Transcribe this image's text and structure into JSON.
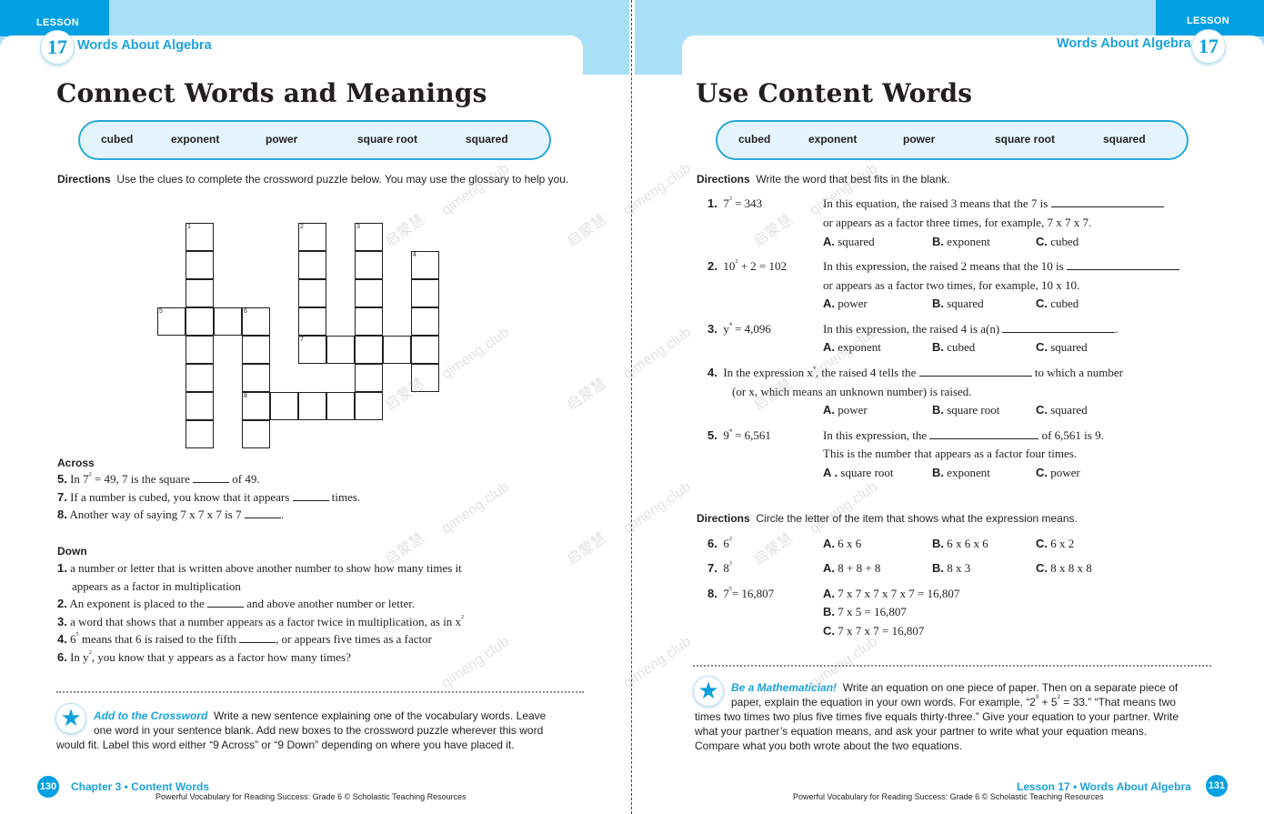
{
  "colors": {
    "accent": "#00a0e3",
    "band": "#a9dff7",
    "word_box_fill": "#e4f4fc",
    "word_box_border": "#29a8dd",
    "text": "#231f20"
  },
  "left": {
    "lesson_label": "LESSON",
    "lesson_number": "17",
    "lesson_title": "Words About Algebra",
    "heading": "Connect Words and Meanings",
    "word_bank": [
      "cubed",
      "exponent",
      "power",
      "square root",
      "squared"
    ],
    "directions_label": "Directions",
    "directions_text": "Use the clues to complete the crossword puzzle below. You may use the glossary to help you.",
    "crossword_numbers": [
      "1",
      "2",
      "3",
      "4",
      "5",
      "6",
      "7",
      "8"
    ],
    "across_label": "Across",
    "across": [
      {
        "n": "5.",
        "a": "In 7",
        "sup": "2",
        "b": " = 49, 7 is the square ",
        "c": " of 49."
      },
      {
        "n": "7.",
        "a": "If a number is cubed, you know that it appears ",
        "c": " times."
      },
      {
        "n": "8.",
        "a": "Another way of saying 7 x 7 x 7 is 7 ",
        "c": "."
      }
    ],
    "down_label": "Down",
    "down": [
      {
        "n": "1.",
        "a": "a number or letter that is written above another number to show how many times it",
        "a2": "appears as a factor in multiplication"
      },
      {
        "n": "2.",
        "a": "An exponent is placed to the ",
        "c": " and above another number or letter."
      },
      {
        "n": "3.",
        "a": "a word that shows that a number appears as a factor twice in multiplication, as in x",
        "sup": "2"
      },
      {
        "n": "4.",
        "a": "6",
        "sup": "5",
        "b": " means that 6 is raised to the fifth ",
        "c": ", or appears five times as a factor"
      },
      {
        "n": "6.",
        "a": "In y",
        "sup": "2",
        "b": ", you know that y appears as a factor how many times?"
      }
    ],
    "activity_title": "Add to the Crossword",
    "activity_line1": "Write a new sentence explaining one of the vocabulary words. Leave",
    "activity_line2": "one word in your sentence blank. Add new boxes to the crossword puzzle wherever this word",
    "activity_line3": "would fit. Label this word either “9 Across” or “9 Down” depending on where you have placed it.",
    "page_number": "130",
    "footer_chapter": "Chapter 3  •  Content Words",
    "footer_credit": "Powerful Vocabulary for Reading Success: Grade 6 © Scholastic Teaching Resources"
  },
  "right": {
    "lesson_label": "LESSON",
    "lesson_number": "17",
    "lesson_title": "Words About Algebra",
    "heading": "Use Content Words",
    "word_bank": [
      "cubed",
      "exponent",
      "power",
      "square root",
      "squared"
    ],
    "directions1_label": "Directions",
    "directions1_text": "Write the word that best fits in the blank.",
    "questions": [
      {
        "n": "1.",
        "expr": "7",
        "sup": "3",
        "expr2": " = 343",
        "line1": "In this equation, the raised 3 means that the 7 is",
        "line2": "or appears as a factor three times, for example, 7 x 7 x 7.",
        "opts": [
          "squared",
          "exponent",
          "cubed"
        ]
      },
      {
        "n": "2.",
        "expr": "10",
        "sup": "2",
        "expr2": " + 2 = 102",
        "line1": "In this expression, the raised 2 means that the 10 is",
        "line2": "or appears as a factor two times, for example, 10 x 10.",
        "opts": [
          "power",
          "squared",
          "cubed"
        ]
      },
      {
        "n": "3.",
        "expr": "y",
        "sup": "4",
        "expr2": " = 4,096",
        "line1": "In this expression, the raised 4 is a(n)",
        "line1b": ".",
        "opts": [
          "exponent",
          "cubed",
          "squared"
        ]
      },
      {
        "n": "4.",
        "line1a": "In the expression x",
        "sup": "4",
        "line1b": ", the raised 4 tells the",
        "line1c": "to which a number",
        "line2": "(or x, which means an unknown number) is raised.",
        "opts": [
          "power",
          "square root",
          "squared"
        ]
      },
      {
        "n": "5.",
        "expr": "9",
        "sup": "4",
        "expr2": " = 6,561",
        "line1": "In this expression, the",
        "line1b": "of 6,561 is 9.",
        "line2": "This is the number that appears as a factor four times.",
        "opts": [
          "square root",
          "exponent",
          "power"
        ]
      }
    ],
    "opt_letters": [
      "A.",
      "B.",
      "C."
    ],
    "opt_letter_a5": "A .",
    "directions2_label": "Directions",
    "directions2_text": "Circle the letter of the item that shows what the expression means.",
    "mc": [
      {
        "n": "6.",
        "expr": "6",
        "sup": "2",
        "expr2": "",
        "opts": [
          "6 x 6",
          "6 x 6 x 6",
          "6 x 2"
        ]
      },
      {
        "n": "7.",
        "expr": "8",
        "sup": "3",
        "expr2": "",
        "opts": [
          "8 + 8 + 8",
          "8 x 3",
          "8 x 8 x 8"
        ]
      },
      {
        "n": "8.",
        "expr": "7",
        "sup": "5",
        "expr2": "= 16,807",
        "opts": [
          "7 x 7 x 7 x 7 x 7 = 16,807",
          "7 x 5 = 16,807",
          "7 x 7 x 7 = 16,807"
        ]
      }
    ],
    "activity_title": "Be a Mathematician!",
    "activity_line1": "Write an equation on one piece of paper. Then on a separate piece of",
    "activity_line2a": "paper, explain the equation in your own words. For example, “2",
    "activity_line2_sup1": "3",
    "activity_line2b": " + 5",
    "activity_line2_sup2": "2",
    "activity_line2c": " = 33.” “That means two",
    "activity_line3": "times two times two plus five times five equals thirty-three.” Give your equation to your partner. Write",
    "activity_line4": "what your partner’s equation means, and ask your partner to write what your equation means.",
    "activity_line5": "Compare what you both wrote about the two equations.",
    "page_number": "131",
    "footer_chapter": "Lesson 17  •  Words About Algebra",
    "footer_credit": "Powerful Vocabulary for Reading Success: Grade 6 © Scholastic Teaching Resources"
  },
  "watermark": [
    "启蒙慧",
    "qimeng.club"
  ]
}
